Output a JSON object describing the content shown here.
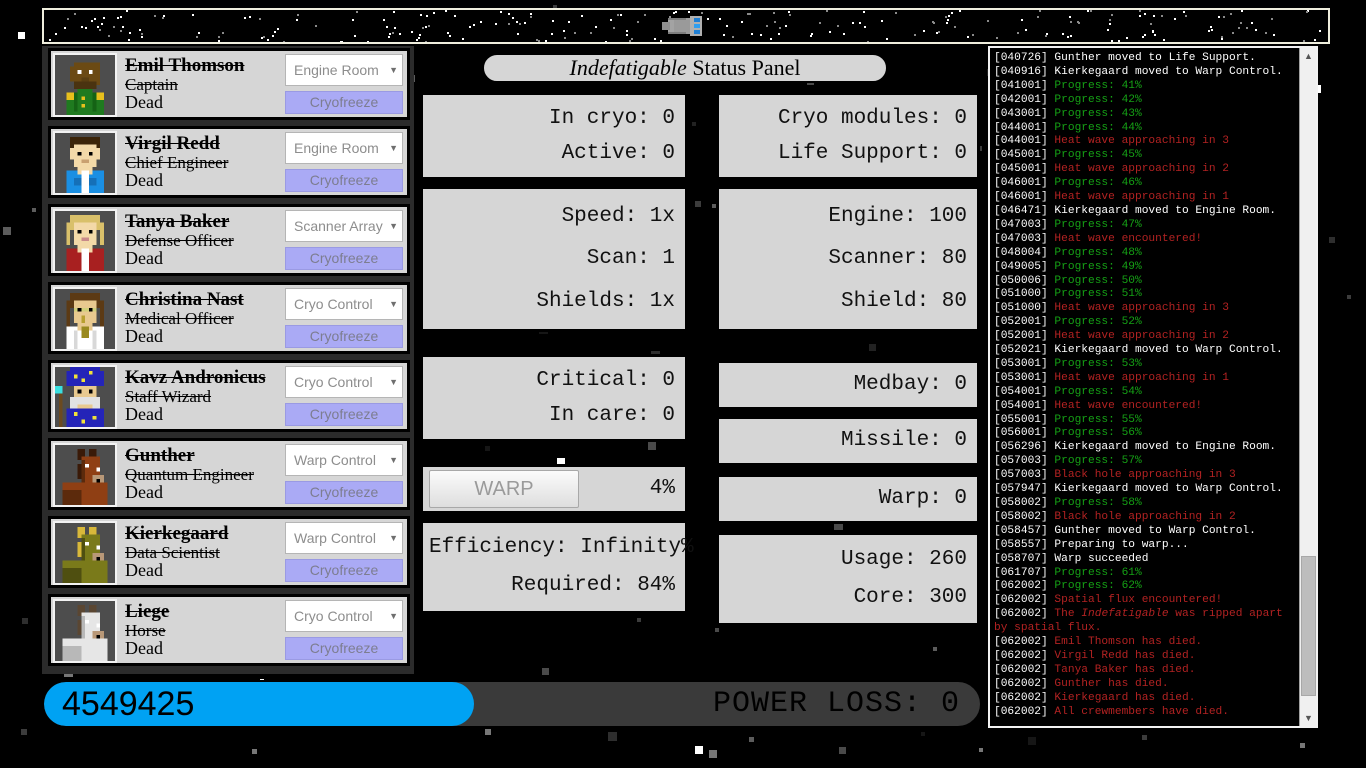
{
  "banner": {
    "ship_icon": "spaceship-icon"
  },
  "crew": {
    "select_caret": "▼",
    "members": [
      {
        "name": "Emil Thomson",
        "role": "Captain",
        "status": "Dead",
        "room": "Engine Room",
        "action": "Cryofreeze",
        "avatar": "captain"
      },
      {
        "name": "Virgil Redd",
        "role": "Chief Engineer",
        "status": "Dead",
        "room": "Engine Room",
        "action": "Cryofreeze",
        "avatar": "engineer"
      },
      {
        "name": "Tanya Baker",
        "role": "Defense Officer",
        "status": "Dead",
        "room": "Scanner Array",
        "action": "Cryofreeze",
        "avatar": "defense"
      },
      {
        "name": "Christina Nast",
        "role": "Medical Officer",
        "status": "Dead",
        "room": "Cryo Control",
        "action": "Cryofreeze",
        "avatar": "medic"
      },
      {
        "name": "Kavz Andronicus",
        "role": "Staff Wizard",
        "status": "Dead",
        "room": "Cryo Control",
        "action": "Cryofreeze",
        "avatar": "wizard"
      },
      {
        "name": "Gunther",
        "role": "Quantum Engineer",
        "status": "Dead",
        "room": "Warp Control",
        "action": "Cryofreeze",
        "avatar": "horse-brown"
      },
      {
        "name": "Kierkegaard",
        "role": "Data Scientist",
        "status": "Dead",
        "room": "Warp Control",
        "action": "Cryofreeze",
        "avatar": "horse-olive"
      },
      {
        "name": "Liege",
        "role": "Horse",
        "status": "Dead",
        "room": "Cryo Control",
        "action": "Cryofreeze",
        "avatar": "horse-white"
      }
    ]
  },
  "panel": {
    "title_ship": "Indefatigable",
    "title_rest": " Status Panel",
    "stats": {
      "in_cryo": "In cryo: 0",
      "active": "Active: 0",
      "speed": "Speed: 1x",
      "scan": "Scan: 1",
      "shields": "Shields: 1x",
      "critical": "Critical: 0",
      "in_care": "In care: 0",
      "warp_button": "WARP",
      "warp_percent": "4%",
      "efficiency": "Efficiency: Infinity%",
      "required": "Required: 84%",
      "cryo_modules": "Cryo modules: 0",
      "life_support": "Life Support: 0",
      "engine": "Engine: 100",
      "scanner": "Scanner: 80",
      "shield": "Shield: 80",
      "medbay": "Medbay: 0",
      "missile": "Missile: 0",
      "warp": "Warp: 0",
      "usage": "Usage: 260",
      "core": "Core: 300"
    }
  },
  "log": {
    "scroll_up_icon": "▲",
    "scroll_down_icon": "▼",
    "lines": [
      {
        "ts": "[040726]",
        "text": " Gunther moved to Life Support.",
        "color": "white"
      },
      {
        "ts": "[040916]",
        "text": " Kierkegaard moved to Warp Control.",
        "color": "white"
      },
      {
        "ts": "[041001]",
        "text": " Progress: 41%",
        "color": "green"
      },
      {
        "ts": "[042001]",
        "text": " Progress: 42%",
        "color": "green"
      },
      {
        "ts": "[043001]",
        "text": " Progress: 43%",
        "color": "green"
      },
      {
        "ts": "[044001]",
        "text": " Progress: 44%",
        "color": "green"
      },
      {
        "ts": "[044001]",
        "text": " Heat wave approaching in 3",
        "color": "red"
      },
      {
        "ts": "[045001]",
        "text": " Progress: 45%",
        "color": "green"
      },
      {
        "ts": "[045001]",
        "text": " Heat wave approaching in 2",
        "color": "red"
      },
      {
        "ts": "[046001]",
        "text": " Progress: 46%",
        "color": "green"
      },
      {
        "ts": "[046001]",
        "text": " Heat wave approaching in 1",
        "color": "red"
      },
      {
        "ts": "[046471]",
        "text": " Kierkegaard moved to Engine Room.",
        "color": "white"
      },
      {
        "ts": "[047003]",
        "text": " Progress: 47%",
        "color": "green"
      },
      {
        "ts": "[047003]",
        "text": " Heat wave encountered!",
        "color": "red"
      },
      {
        "ts": "[048004]",
        "text": " Progress: 48%",
        "color": "green"
      },
      {
        "ts": "[049005]",
        "text": " Progress: 49%",
        "color": "green"
      },
      {
        "ts": "[050006]",
        "text": " Progress: 50%",
        "color": "green"
      },
      {
        "ts": "[051000]",
        "text": " Progress: 51%",
        "color": "green"
      },
      {
        "ts": "[051000]",
        "text": " Heat wave approaching in 3",
        "color": "red"
      },
      {
        "ts": "[052001]",
        "text": " Progress: 52%",
        "color": "green"
      },
      {
        "ts": "[052001]",
        "text": " Heat wave approaching in 2",
        "color": "red"
      },
      {
        "ts": "[052021]",
        "text": " Kierkegaard moved to Warp Control.",
        "color": "white"
      },
      {
        "ts": "[053001]",
        "text": " Progress: 53%",
        "color": "green"
      },
      {
        "ts": "[053001]",
        "text": " Heat wave approaching in 1",
        "color": "red"
      },
      {
        "ts": "[054001]",
        "text": " Progress: 54%",
        "color": "green"
      },
      {
        "ts": "[054001]",
        "text": " Heat wave encountered!",
        "color": "red"
      },
      {
        "ts": "[055001]",
        "text": " Progress: 55%",
        "color": "green"
      },
      {
        "ts": "[056001]",
        "text": " Progress: 56%",
        "color": "green"
      },
      {
        "ts": "[056296]",
        "text": " Kierkegaard moved to Engine Room.",
        "color": "white"
      },
      {
        "ts": "[057003]",
        "text": " Progress: 57%",
        "color": "green"
      },
      {
        "ts": "[057003]",
        "text": " Black hole approaching in 3",
        "color": "red"
      },
      {
        "ts": "[057947]",
        "text": " Kierkegaard moved to Warp Control.",
        "color": "white"
      },
      {
        "ts": "[058002]",
        "text": " Progress: 58%",
        "color": "green"
      },
      {
        "ts": "[058002]",
        "text": " Black hole approaching in 2",
        "color": "red"
      },
      {
        "ts": "[058457]",
        "text": " Gunther moved to Warp Control.",
        "color": "white"
      },
      {
        "ts": "[058557]",
        "text": " Preparing to warp...",
        "color": "white"
      },
      {
        "ts": "[058707]",
        "text": " Warp succeeded",
        "color": "white"
      },
      {
        "ts": "[061707]",
        "text": " Progress: 61%",
        "color": "green"
      },
      {
        "ts": "[062002]",
        "text": " Progress: 62%",
        "color": "green"
      },
      {
        "ts": "[062002]",
        "text": " Spatial flux encountered!",
        "color": "red"
      },
      {
        "ts": "[062002]",
        "text": " The Indefatigable was ripped apart by spatial flux.",
        "color": "red",
        "italic_word": "Indefatigable"
      },
      {
        "ts": "[062002]",
        "text": " Emil Thomson has died.",
        "color": "red"
      },
      {
        "ts": "[062002]",
        "text": " Virgil Redd has died.",
        "color": "red"
      },
      {
        "ts": "[062002]",
        "text": " Tanya Baker has died.",
        "color": "red"
      },
      {
        "ts": "[062002]",
        "text": " Gunther has died.",
        "color": "red"
      },
      {
        "ts": "[062002]",
        "text": " Kierkegaard has died.",
        "color": "red"
      },
      {
        "ts": "[062002]",
        "text": " All crewmembers have died.",
        "color": "red"
      }
    ]
  },
  "bottom": {
    "score": "4549425",
    "power_loss": "POWER LOSS: 0"
  },
  "colors": {
    "accent_blue": "#00a2f3",
    "cryo_button": "#aaaaf5",
    "log_green": "#15a015",
    "log_red": "#b22222",
    "panel_gray": "#d6d6d6"
  }
}
